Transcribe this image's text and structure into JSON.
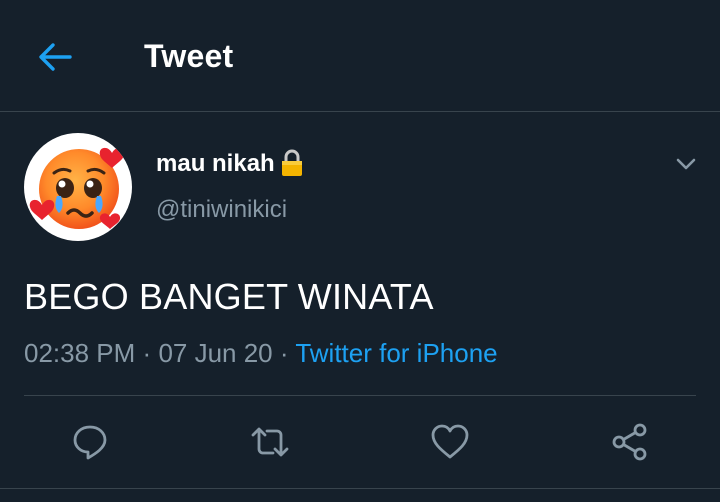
{
  "header": {
    "title": "Tweet",
    "back_icon": "arrow-left-icon"
  },
  "tweet": {
    "display_name": "mau nikah",
    "handle": "@tiniwinikici",
    "protected_icon": "lock-icon",
    "avatar_icon": "pleading-face-with-hearts",
    "text": "BEGO BANGET WINATA",
    "time": "02:38 PM",
    "separator": "·",
    "date": "07 Jun 20",
    "source": "Twitter for iPhone"
  },
  "actions": [
    "reply-icon",
    "retweet-icon",
    "like-icon",
    "share-icon"
  ],
  "colors": {
    "background": "#15202b",
    "accent": "#1da1f2",
    "muted": "#8899a6",
    "border": "#38444d"
  }
}
